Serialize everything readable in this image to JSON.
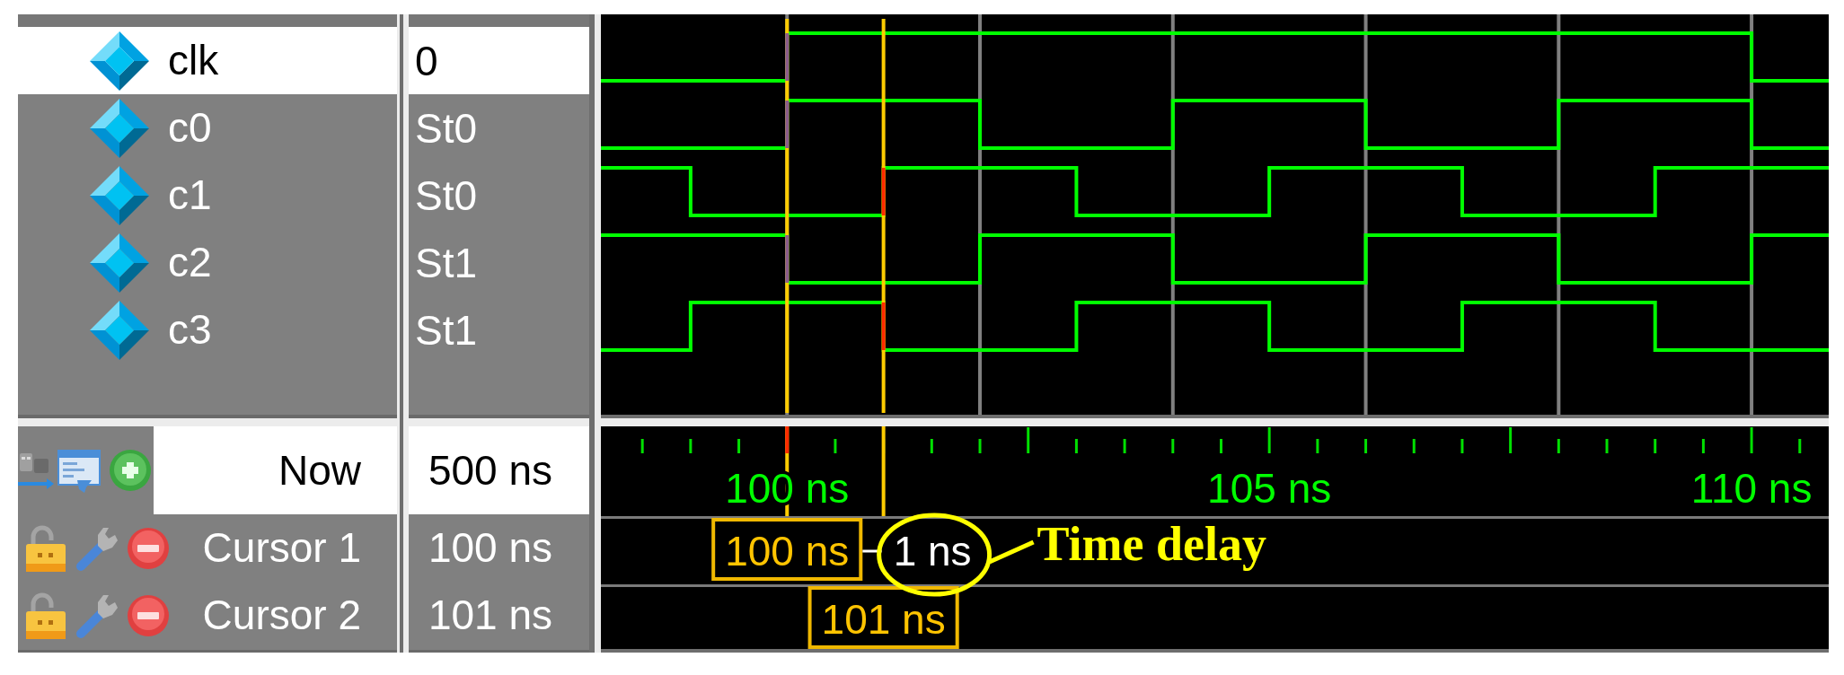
{
  "signals": [
    {
      "name": "clk",
      "value": "0",
      "selected": true
    },
    {
      "name": "c0",
      "value": "St0",
      "selected": false
    },
    {
      "name": "c1",
      "value": "St0",
      "selected": false
    },
    {
      "name": "c2",
      "value": "St1",
      "selected": false
    },
    {
      "name": "c3",
      "value": "St1",
      "selected": false
    }
  ],
  "cursor_panel": {
    "now": {
      "label": "Now",
      "value": "500 ns"
    },
    "cursors": [
      {
        "label": "Cursor 1",
        "value": "100 ns"
      },
      {
        "label": "Cursor 2",
        "value": "101 ns"
      }
    ]
  },
  "waveform": {
    "time_scale": [
      "100 ns",
      "105 ns",
      "110 ns"
    ],
    "cursor_labels": [
      "100 ns",
      "101 ns"
    ],
    "cursor_delta": "1 ns",
    "callout": "Time delay"
  }
}
